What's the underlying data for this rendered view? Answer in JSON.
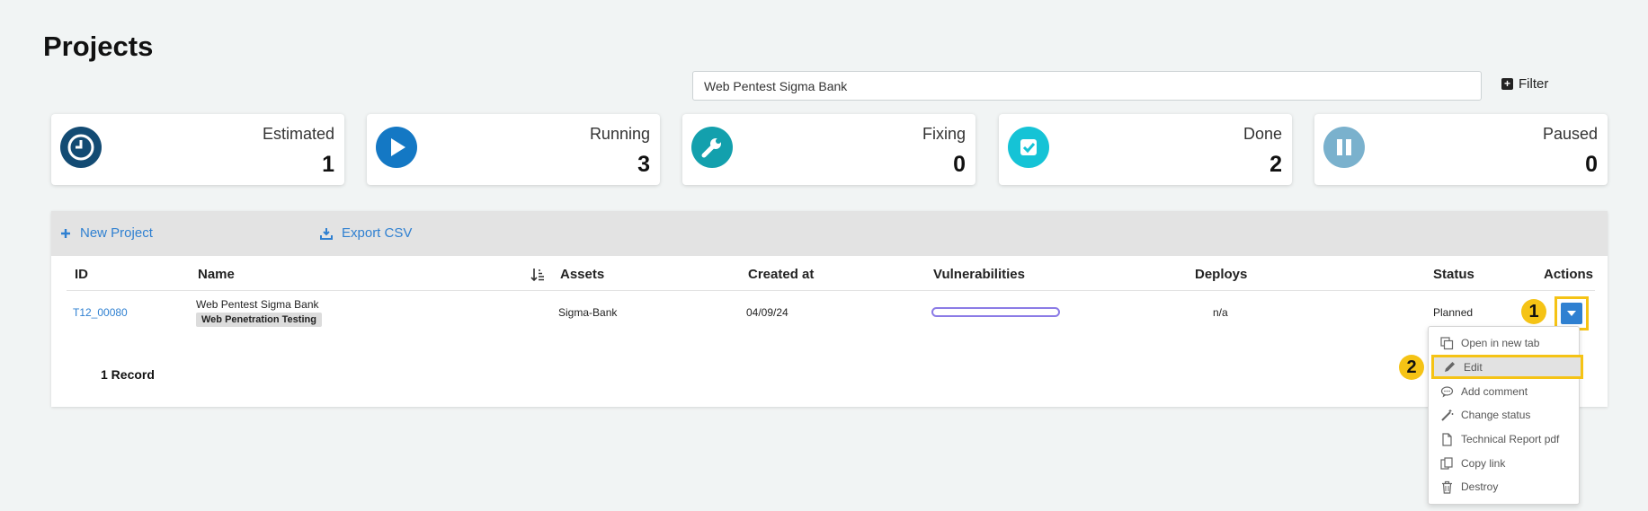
{
  "page": {
    "title": "Projects"
  },
  "search": {
    "value": "Web Pentest Sigma Bank",
    "placeholder": ""
  },
  "filter": {
    "label": "Filter"
  },
  "cards": [
    {
      "label": "Estimated",
      "count": "1",
      "icon": "clock-icon",
      "color": "#134b73"
    },
    {
      "label": "Running",
      "count": "3",
      "icon": "play-icon",
      "color": "#1478c4"
    },
    {
      "label": "Fixing",
      "count": "0",
      "icon": "wrench-icon",
      "color": "#13a0ad"
    },
    {
      "label": "Done",
      "count": "2",
      "icon": "checkbox-icon",
      "color": "#15c3d6"
    },
    {
      "label": "Paused",
      "count": "0",
      "icon": "pause-icon",
      "color": "#7ab1cd"
    }
  ],
  "toolbar": {
    "new_project": "New Project",
    "export_csv": "Export CSV"
  },
  "table": {
    "headers": {
      "id": "ID",
      "name": "Name",
      "assets": "Assets",
      "created_at": "Created at",
      "vulnerabilities": "Vulnerabilities",
      "deploys": "Deploys",
      "status": "Status",
      "actions": "Actions"
    },
    "rows": [
      {
        "id": "T12_00080",
        "name": "Web Pentest Sigma Bank",
        "tag": "Web Penetration Testing",
        "assets": "Sigma-Bank",
        "created_at": "04/09/24",
        "deploys": "n/a",
        "status": "Planned"
      }
    ],
    "record_count": "1 Record"
  },
  "annotations": {
    "step1": "1",
    "step2": "2"
  },
  "menu": {
    "items": [
      {
        "label": "Open in new tab",
        "icon": "copy-tab-icon"
      },
      {
        "label": "Edit",
        "icon": "pencil-icon"
      },
      {
        "label": "Add comment",
        "icon": "comment-icon"
      },
      {
        "label": "Change status",
        "icon": "magic-wand-icon"
      },
      {
        "label": "Technical Report pdf",
        "icon": "document-icon"
      },
      {
        "label": "Copy link",
        "icon": "copy-link-icon"
      },
      {
        "label": "Destroy",
        "icon": "trash-icon"
      }
    ]
  },
  "colors": {
    "accent": "#2f80d1",
    "highlight": "#f5c315",
    "vuln_bar": "#8b7be6"
  }
}
